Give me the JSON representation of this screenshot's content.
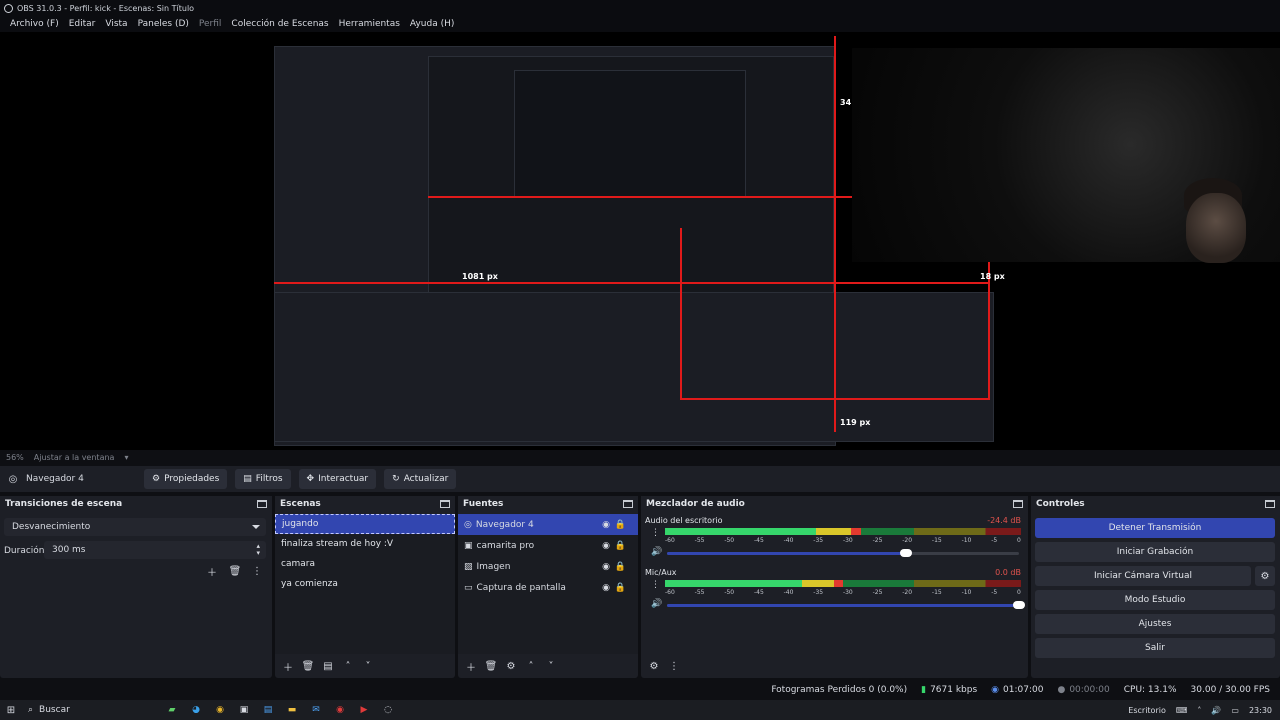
{
  "window": {
    "title": "OBS 31.0.3 - Perfil: kick - Escenas: Sin Título"
  },
  "menu": [
    {
      "label": "Archivo (F)",
      "dim": false
    },
    {
      "label": "Editar",
      "dim": false
    },
    {
      "label": "Vista",
      "dim": false
    },
    {
      "label": "Paneles (D)",
      "dim": false
    },
    {
      "label": "Perfil",
      "dim": true
    },
    {
      "label": "Colección de Escenas",
      "dim": false
    },
    {
      "label": "Herramientas",
      "dim": false
    },
    {
      "label": "Ayuda (H)",
      "dim": false
    }
  ],
  "preview": {
    "labels": [
      "1081 px",
      "18 px",
      "119 px",
      "34"
    ]
  },
  "zoom": {
    "percent": "56%",
    "fit_label": "Ajustar a la ventana"
  },
  "source_toolbar": {
    "source_name": "Navegador 4",
    "properties": "Propiedades",
    "filters": "Filtros",
    "interact": "Interactuar",
    "refresh": "Actualizar"
  },
  "transitions": {
    "title": "Transiciones de escena",
    "selected": "Desvanecimiento",
    "duration_label": "Duración",
    "duration_value": "300 ms"
  },
  "scenes": {
    "title": "Escenas",
    "items": [
      "jugando",
      "finaliza stream de hoy :V",
      "camara",
      "ya comienza"
    ],
    "selected_index": 0
  },
  "sources": {
    "title": "Fuentes",
    "items": [
      {
        "label": "Navegador 4",
        "icon": "globe-icon"
      },
      {
        "label": "camarita pro",
        "icon": "camera-icon"
      },
      {
        "label": "Imagen",
        "icon": "image-icon"
      },
      {
        "label": "Captura de pantalla",
        "icon": "monitor-icon"
      }
    ],
    "selected_index": 0
  },
  "mixer": {
    "title": "Mezclador de audio",
    "scale": [
      "-60",
      "-55",
      "-50",
      "-45",
      "-40",
      "-35",
      "-30",
      "-25",
      "-20",
      "-15",
      "-10",
      "-5",
      "0"
    ],
    "channels": [
      {
        "name": "Audio del escritorio",
        "db": "-24.4 dB",
        "level": 0.55,
        "fader": 0.68
      },
      {
        "name": "Mic/Aux",
        "db": "0.0 dB",
        "level": 0.5,
        "fader": 1.0
      }
    ]
  },
  "controls": {
    "title": "Controles",
    "buttons": [
      {
        "label": "Detener Transmisión",
        "primary": true
      },
      {
        "label": "Iniciar Grabación",
        "primary": false
      },
      {
        "label": "Iniciar Cámara Virtual",
        "primary": false
      },
      {
        "label": "Modo Estudio",
        "primary": false
      },
      {
        "label": "Ajustes",
        "primary": false
      },
      {
        "label": "Salir",
        "primary": false
      }
    ]
  },
  "status": {
    "dropped_frames": "Fotogramas Perdidos 0 (0.0%)",
    "bitrate": "7671 kbps",
    "stream_time": "01:07:00",
    "rec_time": "00:00:00",
    "cpu": "CPU: 13.1%",
    "fps": "30.00 / 30.00 FPS"
  },
  "taskbar": {
    "search": "Buscar",
    "desktop": "Escritorio",
    "time": "23:30"
  },
  "colors": {
    "accent": "#3246b0",
    "guide": "#e01a1a",
    "meter_green": "#36d66b"
  }
}
